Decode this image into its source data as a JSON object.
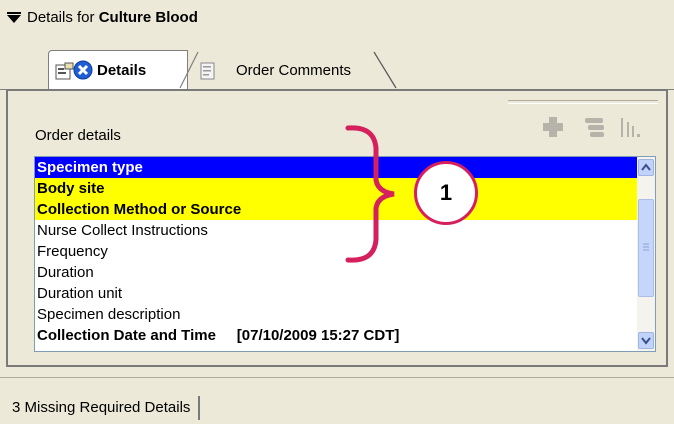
{
  "header": {
    "prefix": "Details for",
    "order_name": "Culture Blood"
  },
  "tabs": [
    {
      "label": "Details",
      "active": true
    },
    {
      "label": "Order Comments",
      "active": false
    }
  ],
  "toolbar": {
    "icons": [
      "add-icon",
      "remove-icon",
      "chart-icon"
    ]
  },
  "section_label": "Order details",
  "details_list": [
    {
      "label": "Specimen type",
      "state": "selected",
      "bold": true
    },
    {
      "label": "Body site",
      "state": "required",
      "bold": true
    },
    {
      "label": "Collection Method or Source",
      "state": "required",
      "bold": true
    },
    {
      "label": "Nurse Collect  Instructions",
      "state": "normal",
      "bold": false
    },
    {
      "label": "Frequency",
      "state": "normal",
      "bold": false
    },
    {
      "label": "Duration",
      "state": "normal",
      "bold": false
    },
    {
      "label": "Duration unit",
      "state": "normal",
      "bold": false
    },
    {
      "label": "Specimen description",
      "state": "normal",
      "bold": false
    },
    {
      "label": "Collection Date and Time     [07/10/2009 15:27 CDT]",
      "state": "normal",
      "bold": true
    }
  ],
  "annotation": {
    "callout_number": "1"
  },
  "status": {
    "text": "3 Missing Required Details"
  },
  "colors": {
    "selected_row": "#0000ff",
    "required_row": "#ffff00",
    "annotation": "#d6205e",
    "panel_bg": "#ece9d8"
  }
}
